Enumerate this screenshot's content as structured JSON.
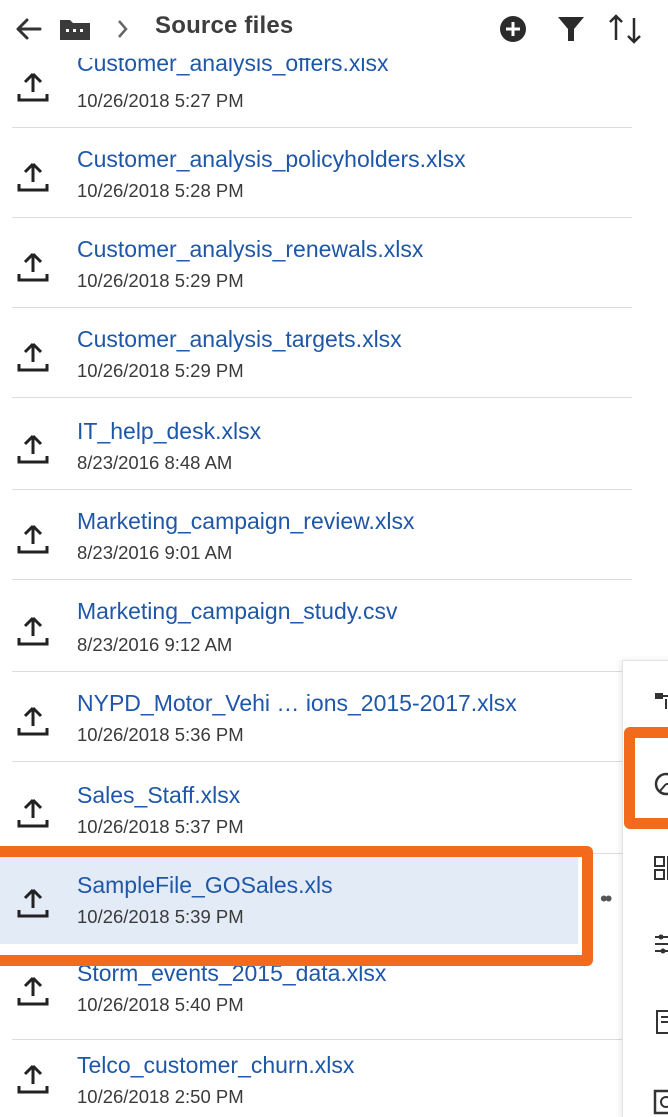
{
  "header": {
    "title": "Source files",
    "icons": {
      "back": "arrow-left-icon",
      "folder": "folder-icon",
      "separator": "chevron-right-icon",
      "add": "add-circle-icon",
      "filter": "filter-icon",
      "sort": "sort-icon"
    }
  },
  "files": [
    {
      "name": "Customer_analysis_offers.xlsx",
      "date": "10/26/2018 5:27 PM"
    },
    {
      "name": "Customer_analysis_policyholders.xlsx",
      "date": "10/26/2018 5:28 PM"
    },
    {
      "name": "Customer_analysis_renewals.xlsx",
      "date": "10/26/2018 5:29 PM"
    },
    {
      "name": "Customer_analysis_targets.xlsx",
      "date": "10/26/2018 5:29 PM"
    },
    {
      "name": "IT_help_desk.xlsx",
      "date": "8/23/2016 8:48 AM"
    },
    {
      "name": "Marketing_campaign_review.xlsx",
      "date": "8/23/2016 9:01 AM"
    },
    {
      "name": "Marketing_campaign_study.csv",
      "date": "8/23/2016 9:12 AM"
    },
    {
      "name": "NYPD_Motor_Vehi … ions_2015-2017.xlsx",
      "date": "10/26/2018 5:36 PM"
    },
    {
      "name": "Sales_Staff.xlsx",
      "date": "10/26/2018 5:37 PM"
    },
    {
      "name": "SampleFile_GOSales.xls",
      "date": "10/26/2018 5:39 PM",
      "selected": true,
      "more": "••"
    },
    {
      "name": "Storm_events_2015_data.xlsx",
      "date": "10/26/2018 5:40 PM"
    },
    {
      "name": "Telco_customer_churn.xlsx",
      "date": "10/26/2018 2:50 PM"
    }
  ],
  "row_icon": "upload-icon",
  "side_menu": {
    "icons": [
      "flow-icon",
      "explore-icon",
      "dashboard-icon",
      "settings-sliders-icon",
      "report-icon",
      "story-icon"
    ]
  },
  "colors": {
    "link": "#1f57a8",
    "selected_bg": "#e3ebf7",
    "highlight": "#f26a1b",
    "header_text": "#3d3d3d"
  }
}
